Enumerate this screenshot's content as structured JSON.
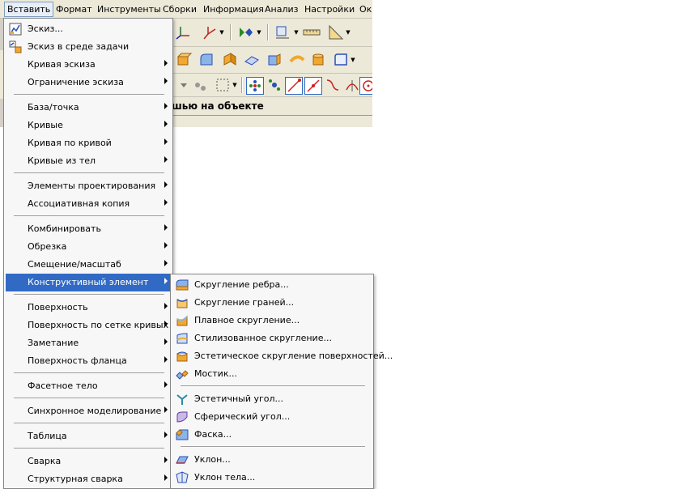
{
  "menubar": {
    "items": [
      "Вставить",
      "Формат",
      "Инструменты",
      "Сборки",
      "Информация",
      "Анализ",
      "Настройки",
      "Окн"
    ]
  },
  "selection_bar": {
    "hint": "шью на объекте"
  },
  "insert_menu": {
    "items": [
      {
        "label": "Эскиз...",
        "icon": "sketch-icon"
      },
      {
        "label": "Эскиз в среде задачи",
        "icon": "task-sketch-icon"
      },
      {
        "label": "Кривая эскиза",
        "submenu": true
      },
      {
        "label": "Ограничение эскиза",
        "submenu": true
      },
      {
        "label": "База/точка",
        "submenu": true
      },
      {
        "label": "Кривые",
        "submenu": true
      },
      {
        "label": "Кривая по кривой",
        "submenu": true
      },
      {
        "label": "Кривые из тел",
        "submenu": true
      },
      {
        "label": "Элементы проектирования",
        "submenu": true
      },
      {
        "label": "Ассоциативная копия",
        "submenu": true
      },
      {
        "label": "Комбинировать",
        "submenu": true
      },
      {
        "label": "Обрезка",
        "submenu": true
      },
      {
        "label": "Смещение/масштаб",
        "submenu": true
      },
      {
        "label": "Конструктивный элемент",
        "submenu": true,
        "highlighted": true
      },
      {
        "label": "Поверхность",
        "submenu": true
      },
      {
        "label": "Поверхность по сетке кривых",
        "submenu": true
      },
      {
        "label": "Заметание",
        "submenu": true
      },
      {
        "label": "Поверхность фланца",
        "submenu": true
      },
      {
        "label": "Фасетное тело",
        "submenu": true
      },
      {
        "label": "Синхронное моделирование",
        "submenu": true
      },
      {
        "label": "Таблица",
        "submenu": true
      },
      {
        "label": "Сварка",
        "submenu": true
      },
      {
        "label": "Структурная сварка",
        "submenu": true
      }
    ]
  },
  "feature_submenu": {
    "items": [
      {
        "label": "Скругление ребра...",
        "icon": "edge-blend-icon"
      },
      {
        "label": "Скругление граней...",
        "icon": "face-blend-icon"
      },
      {
        "label": "Плавное скругление...",
        "icon": "soft-blend-icon"
      },
      {
        "label": "Стилизованное скругление...",
        "icon": "styled-blend-icon"
      },
      {
        "label": "Эстетическое скругление поверхностей...",
        "icon": "aesthetic-face-blend-icon"
      },
      {
        "label": "Мостик...",
        "icon": "bridge-icon"
      },
      {
        "label": "Эстетичный угол...",
        "icon": "styled-corner-icon"
      },
      {
        "label": "Сферический угол...",
        "icon": "spherical-corner-icon"
      },
      {
        "label": "Фаска...",
        "icon": "chamfer-icon"
      },
      {
        "label": "Уклон...",
        "icon": "draft-icon"
      },
      {
        "label": "Уклон тела...",
        "icon": "draft-body-icon"
      }
    ]
  },
  "colors": {
    "highlight": "#316ac5",
    "menu_bg": "#f7f7f7",
    "chrome": "#ece9d8"
  }
}
